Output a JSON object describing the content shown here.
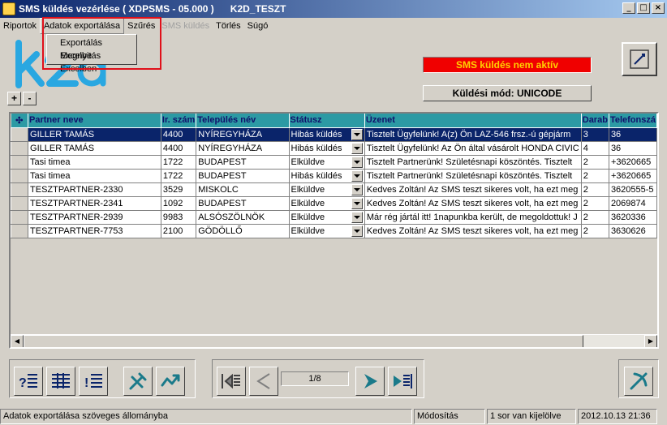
{
  "window": {
    "title": "SMS küldés vezérlése ( XDPSMS - 05.000 )      K2D_TESZT",
    "buttons": {
      "minimize": "_",
      "maximize": "□",
      "close": "×"
    }
  },
  "menu": {
    "items": [
      "Riportok",
      "Adatok exportálása",
      "Szűrés",
      "SMS küldés",
      "Törlés",
      "Súgó"
    ],
    "dropdown": [
      "Exportálás Excelbe",
      "Megnyitás Excelben"
    ]
  },
  "logo": {
    "text": "k2d"
  },
  "status_indicator": "SMS küldés nem aktív",
  "mode_button": "Küldési mód: UNICODE",
  "tree_buttons": {
    "expand": "+",
    "collapse": "-"
  },
  "table": {
    "columns": [
      "Partner neve",
      "Ir. szám",
      "Település név",
      "Státusz",
      "Üzenet",
      "Darab",
      "Telefonszá"
    ],
    "rows": [
      [
        "GILLER TAMÁS",
        "4400",
        "NYÍREGYHÁZA",
        "Hibás küldés",
        "Tisztelt Ügyfelünk! A(z) Ön LAZ-546 frsz.-ú gépjárm",
        "3",
        "36"
      ],
      [
        "GILLER TAMÁS",
        "4400",
        "NYÍREGYHÁZA",
        "Hibás küldés",
        "Tisztelt Ügyfelünk! Az Ön által vásárolt HONDA CIVIC",
        "4",
        "36"
      ],
      [
        "Tasi timea",
        "1722",
        "BUDAPEST",
        "Elküldve",
        "Tisztelt Partnerünk! Születésnapi köszöntés. Tisztelt",
        "2",
        "+3620665"
      ],
      [
        "Tasi timea",
        "1722",
        "BUDAPEST",
        "Hibás küldés",
        "Tisztelt Partnerünk! Születésnapi köszöntés. Tisztelt",
        "2",
        "+3620665"
      ],
      [
        "TESZTPARTNER-2330",
        "3529",
        "MISKOLC",
        "Elküldve",
        "Kedves Zoltán! Az SMS teszt sikeres volt, ha ezt meg",
        "2",
        "3620555-5"
      ],
      [
        "TESZTPARTNER-2341",
        "1092",
        "BUDAPEST",
        "Elküldve",
        "Kedves Zoltán! Az SMS teszt sikeres volt, ha ezt meg",
        "2",
        "2069874"
      ],
      [
        "TESZTPARTNER-2939",
        "9983",
        "ALSÓSZÖLNÖK",
        "Elküldve",
        "Már rég jártál itt! 1napunkba került, de megoldottuk! J",
        "2",
        "3620336"
      ],
      [
        "TESZTPARTNER-7753",
        "2100",
        "GÖDÖLLŐ",
        "Elküldve",
        "Kedves Zoltán! Az SMS teszt sikeres volt, ha ezt meg",
        "2",
        "3630626"
      ]
    ],
    "selected_row": 0
  },
  "pager": {
    "page": "1/8"
  },
  "status_bar": {
    "message": "Adatok exportálása szöveges állományba",
    "mode": "Módosítás",
    "selection": "1 sor van kijelölve",
    "datetime": "2012.10.13 21:36"
  },
  "colors": {
    "title_gradient_start": "#0a246a",
    "title_gradient_end": "#a6caf0",
    "header_bg": "#2c9aa4",
    "header_text": "#10106a",
    "selected_row": "#0a246a",
    "alert_bg": "#f00000",
    "alert_text": "#ffd000",
    "highlight_box": "#e0101a",
    "logo_blue": "#29a7e1"
  }
}
